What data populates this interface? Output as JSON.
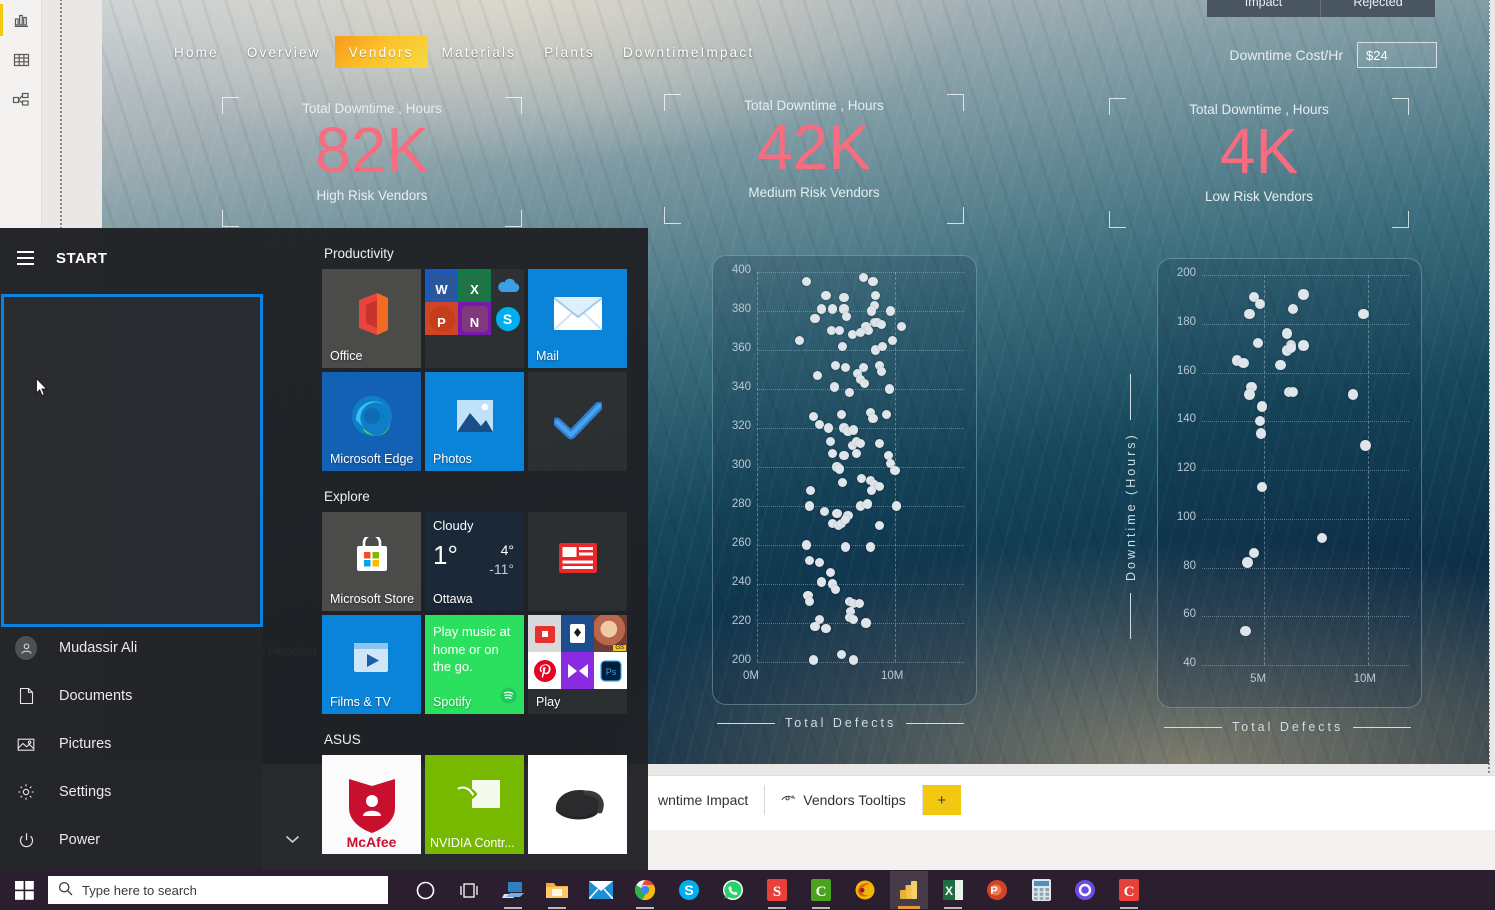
{
  "powerbi": {
    "view_icons": [
      {
        "name": "report-view-icon",
        "label": "Report view"
      },
      {
        "name": "data-view-icon",
        "label": "Data view"
      },
      {
        "name": "model-view-icon",
        "label": "Model view"
      }
    ],
    "page_tabs": [
      {
        "label": "wntime Impact",
        "icon": ""
      },
      {
        "label": "Vendors Tooltips",
        "icon": "tooltip-page-icon"
      }
    ],
    "add_page_label": "+",
    "accent_yellow": "#F2C811"
  },
  "report": {
    "nav": [
      {
        "label": "Home",
        "active": false
      },
      {
        "label": "Overview",
        "active": false
      },
      {
        "label": "Vendors",
        "active": true
      },
      {
        "label": "Materials",
        "active": false
      },
      {
        "label": "Plants",
        "active": false
      },
      {
        "label": "DowntimeImpact",
        "active": false
      }
    ],
    "top_tabs": [
      {
        "label": "Impact"
      },
      {
        "label": "Rejected"
      }
    ],
    "cost": {
      "label": "Downtime Cost/Hr",
      "value": "$24"
    },
    "kpis": [
      {
        "top": "Total Downtime , Hours",
        "value": "82K",
        "sub": "High Risk Vendors"
      },
      {
        "top": "Total Downtime , Hours",
        "value": "42K",
        "sub": "Medium Risk Vendors"
      },
      {
        "top": "Total Downtime , Hours",
        "value": "4K",
        "sub": "Low Risk Vendors"
      }
    ],
    "kpi_value_color": "#F86C7F",
    "shared_axis_y_title": "Downtime (Hours)",
    "shared_axis_x_title": "Total Defects"
  },
  "chart_data": [
    {
      "type": "scatter",
      "title": "",
      "xlabel": "Total Defects",
      "ylabel": "Downtime (Hours)",
      "xlim": [
        0,
        15000000
      ],
      "ylim": [
        200,
        400
      ],
      "xticks": [
        "0M",
        "10M"
      ],
      "yticks": [
        200,
        220,
        240,
        260,
        280,
        300,
        320,
        340,
        360,
        380,
        400
      ],
      "grid": true,
      "legend": "none",
      "series": [
        {
          "name": "High Risk Vendors",
          "points": [
            [
              3600000,
              395
            ],
            [
              7700000,
              397
            ],
            [
              8400000,
              395
            ],
            [
              5000000,
              388
            ],
            [
              8600000,
              388
            ],
            [
              6300000,
              387
            ],
            [
              8500000,
              383
            ],
            [
              4700000,
              381
            ],
            [
              5500000,
              381
            ],
            [
              6300000,
              381
            ],
            [
              8300000,
              380
            ],
            [
              9700000,
              380
            ],
            [
              4200000,
              376
            ],
            [
              6500000,
              377
            ],
            [
              8500000,
              374
            ],
            [
              8700000,
              374
            ],
            [
              9000000,
              373
            ],
            [
              5400000,
              370
            ],
            [
              6000000,
              370
            ],
            [
              7900000,
              372
            ],
            [
              8100000,
              370
            ],
            [
              10500000,
              372
            ],
            [
              3100000,
              365
            ],
            [
              6900000,
              368
            ],
            [
              7500000,
              369
            ],
            [
              9800000,
              365
            ],
            [
              6200000,
              362
            ],
            [
              8600000,
              360
            ],
            [
              9100000,
              362
            ],
            [
              5700000,
              352
            ],
            [
              6400000,
              351
            ],
            [
              7700000,
              351
            ],
            [
              8900000,
              352
            ],
            [
              9000000,
              349
            ],
            [
              4400000,
              347
            ],
            [
              7300000,
              348
            ],
            [
              7500000,
              345
            ],
            [
              7800000,
              343
            ],
            [
              5600000,
              341
            ],
            [
              6700000,
              338
            ],
            [
              9600000,
              340
            ],
            [
              4100000,
              326
            ],
            [
              6100000,
              327
            ],
            [
              8200000,
              328
            ],
            [
              8400000,
              325
            ],
            [
              9400000,
              327
            ],
            [
              4500000,
              322
            ],
            [
              5200000,
              320
            ],
            [
              6300000,
              320
            ],
            [
              6600000,
              318
            ],
            [
              7000000,
              319
            ],
            [
              5300000,
              313
            ],
            [
              6900000,
              311
            ],
            [
              7200000,
              313
            ],
            [
              7500000,
              312
            ],
            [
              8900000,
              312
            ],
            [
              5500000,
              307
            ],
            [
              6300000,
              306
            ],
            [
              7200000,
              307
            ],
            [
              9500000,
              306
            ],
            [
              5800000,
              300
            ],
            [
              6000000,
              299
            ],
            [
              9700000,
              302
            ],
            [
              10000000,
              298
            ],
            [
              6200000,
              292
            ],
            [
              7600000,
              294
            ],
            [
              8200000,
              293
            ],
            [
              8500000,
              291
            ],
            [
              8900000,
              290
            ],
            [
              3900000,
              288
            ],
            [
              8300000,
              288
            ],
            [
              3800000,
              280
            ],
            [
              7500000,
              280
            ],
            [
              8000000,
              281
            ],
            [
              10100000,
              280
            ],
            [
              4900000,
              277
            ],
            [
              5800000,
              276
            ],
            [
              6600000,
              275
            ],
            [
              5500000,
              271
            ],
            [
              5900000,
              270
            ],
            [
              6100000,
              271
            ],
            [
              6400000,
              273
            ],
            [
              8900000,
              270
            ],
            [
              3600000,
              260
            ],
            [
              6400000,
              259
            ],
            [
              8200000,
              259
            ],
            [
              3800000,
              252
            ],
            [
              4500000,
              251
            ],
            [
              5300000,
              246
            ],
            [
              4700000,
              241
            ],
            [
              5500000,
              240
            ],
            [
              5700000,
              237
            ],
            [
              3700000,
              234
            ],
            [
              3800000,
              231
            ],
            [
              6700000,
              231
            ],
            [
              7000000,
              230
            ],
            [
              7400000,
              230
            ],
            [
              6800000,
              226
            ],
            [
              4500000,
              222
            ],
            [
              6700000,
              223
            ],
            [
              7000000,
              222
            ],
            [
              7900000,
              220
            ],
            [
              4200000,
              218
            ],
            [
              5000000,
              217
            ],
            [
              4100000,
              201
            ],
            [
              6100000,
              204
            ],
            [
              7000000,
              201
            ]
          ]
        }
      ]
    },
    {
      "type": "scatter",
      "title": "",
      "xlabel": "Total Defects",
      "ylabel": "Downtime (Hours)",
      "xlim": [
        2000000,
        12000000
      ],
      "ylim": [
        40,
        200
      ],
      "xticks": [
        "5M",
        "10M"
      ],
      "yticks": [
        40,
        60,
        80,
        100,
        120,
        140,
        160,
        180,
        200
      ],
      "grid": true,
      "legend": "none",
      "series": [
        {
          "name": "Low Risk Vendors",
          "points": [
            [
              4500000,
              191
            ],
            [
              6900000,
              192
            ],
            [
              4800000,
              188
            ],
            [
              4300000,
              184
            ],
            [
              6400000,
              186
            ],
            [
              9800000,
              184
            ],
            [
              6100000,
              176
            ],
            [
              4700000,
              172
            ],
            [
              6300000,
              171
            ],
            [
              6900000,
              171
            ],
            [
              6100000,
              169
            ],
            [
              6300000,
              170
            ],
            [
              3700000,
              165
            ],
            [
              4000000,
              164
            ],
            [
              5800000,
              163
            ],
            [
              4400000,
              154
            ],
            [
              4300000,
              151
            ],
            [
              6200000,
              152
            ],
            [
              6400000,
              152
            ],
            [
              9300000,
              151
            ],
            [
              4900000,
              146
            ],
            [
              4800000,
              140
            ],
            [
              4850000,
              135
            ],
            [
              9900000,
              130
            ],
            [
              4900000,
              113
            ],
            [
              7800000,
              92
            ],
            [
              4500000,
              86
            ],
            [
              4200000,
              82
            ],
            [
              4100000,
              54
            ]
          ]
        }
      ]
    }
  ],
  "start_menu": {
    "title": "START",
    "hamburger_icon": "hamburger-icon",
    "links": [
      {
        "label": "Mudassir Ali",
        "icon": "user-avatar-icon"
      },
      {
        "label": "Documents",
        "icon": "document-icon"
      },
      {
        "label": "Pictures",
        "icon": "picture-icon"
      },
      {
        "label": "Settings",
        "icon": "gear-icon"
      },
      {
        "label": "Power",
        "icon": "power-icon"
      }
    ],
    "groups": [
      {
        "title": "Productivity",
        "tiles": [
          {
            "name": "office-tile",
            "label": "Office"
          },
          {
            "name": "office-apps-quad-tile",
            "label": ""
          },
          {
            "name": "mail-tile",
            "label": "Mail"
          },
          {
            "name": "microsoft-edge-tile",
            "label": "Microsoft Edge"
          },
          {
            "name": "photos-tile",
            "label": "Photos"
          },
          {
            "name": "to-do-tile",
            "label": ""
          }
        ]
      },
      {
        "title": "Explore",
        "tiles": [
          {
            "name": "microsoft-store-tile",
            "label": "Microsoft Store"
          },
          {
            "name": "weather-tile",
            "label": "Ottawa"
          },
          {
            "name": "news-tile",
            "label": ""
          },
          {
            "name": "films-tv-tile",
            "label": "Films & TV"
          },
          {
            "name": "spotify-tile",
            "label": "Spotify"
          },
          {
            "name": "play-tile",
            "label": "Play"
          }
        ]
      },
      {
        "title": "ASUS",
        "tiles": [
          {
            "name": "mcafee-tile",
            "label": "McAfee"
          },
          {
            "name": "nvidia-control-panel-tile",
            "label": "NVIDIA Contr..."
          },
          {
            "name": "headset-tile",
            "label": ""
          }
        ]
      }
    ],
    "weather": {
      "condition": "Cloudy",
      "current": "1°",
      "high": "4°",
      "low": "-11°",
      "city": "Ottawa"
    },
    "spotify": {
      "tagline": "Play music at home or on the go.",
      "label": "Spotify"
    },
    "nvidia_label": "NVIDIA Contr...",
    "mcafee_label": "McAfee",
    "desktop_label_fragment": "y Headset"
  },
  "taskbar": {
    "start_icon": "windows-start-icon",
    "search_placeholder": "Type here to search",
    "search_icon": "search-icon",
    "icons": [
      {
        "name": "cortana-icon"
      },
      {
        "name": "task-view-icon"
      },
      {
        "name": "file-transfer-icon"
      },
      {
        "name": "file-explorer-icon"
      },
      {
        "name": "mail-icon"
      },
      {
        "name": "google-chrome-icon"
      },
      {
        "name": "skype-icon"
      },
      {
        "name": "whatsapp-icon"
      },
      {
        "name": "snagit-icon"
      },
      {
        "name": "camtasia-icon"
      },
      {
        "name": "firefox-icon"
      },
      {
        "name": "power-bi-icon"
      },
      {
        "name": "excel-icon"
      },
      {
        "name": "powerpoint-icon"
      },
      {
        "name": "calculator-icon"
      },
      {
        "name": "o-app-icon"
      },
      {
        "name": "c-app-icon"
      }
    ]
  }
}
